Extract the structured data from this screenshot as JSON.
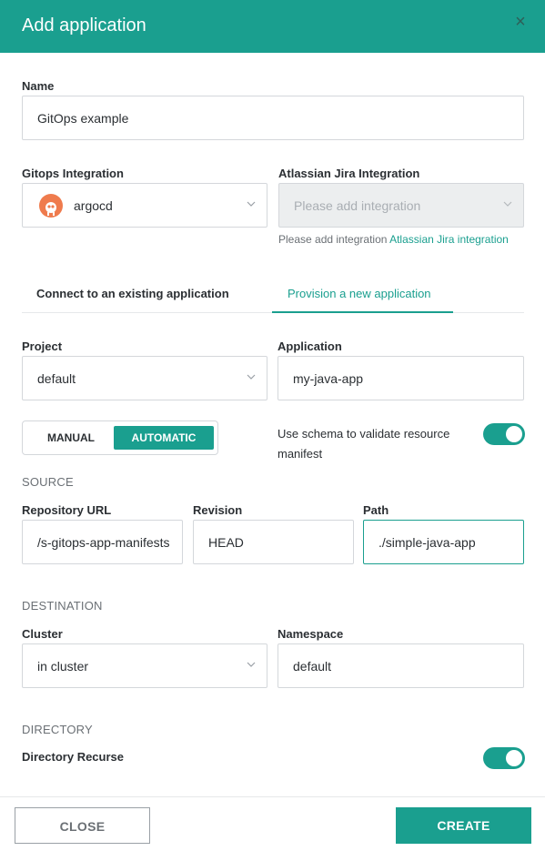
{
  "dialog": {
    "title": "Add application",
    "close_glyph": "×"
  },
  "name": {
    "label": "Name",
    "value": "GitOps example"
  },
  "gitops_integration": {
    "label": "Gitops Integration",
    "value": "argocd",
    "icon": "argo-logo-icon"
  },
  "jira_integration": {
    "label": "Atlassian Jira Integration",
    "placeholder": "Please add integration",
    "hint_prefix": "Please add integration",
    "hint_link": "Atlassian Jira integration"
  },
  "tabs": [
    {
      "label": "Connect to an existing application",
      "active": false
    },
    {
      "label": "Provision a new application",
      "active": true
    }
  ],
  "project": {
    "label": "Project",
    "value": "default"
  },
  "application": {
    "label": "Application",
    "value": "my-java-app"
  },
  "sync_mode": {
    "options": [
      "MANUAL",
      "AUTOMATIC"
    ],
    "selected": "AUTOMATIC"
  },
  "schema_toggle": {
    "label": "Use schema to validate resource manifest",
    "on": true
  },
  "source": {
    "heading": "SOURCE",
    "repo_label": "Repository URL",
    "repo_value": "/s-gitops-app-manifests",
    "revision_label": "Revision",
    "revision_value": "HEAD",
    "path_label": "Path",
    "path_value": "./simple-java-app"
  },
  "destination": {
    "heading": "DESTINATION",
    "cluster_label": "Cluster",
    "cluster_value": "in cluster",
    "namespace_label": "Namespace",
    "namespace_value": "default"
  },
  "directory": {
    "heading": "DIRECTORY",
    "recurse_label": "Directory Recurse",
    "recurse_on": true
  },
  "footer": {
    "close_label": "CLOSE",
    "create_label": "CREATE"
  },
  "colors": {
    "accent": "#1a9f8f",
    "header_bg": "#1a9f8f",
    "logo": "#ef7b4d"
  }
}
